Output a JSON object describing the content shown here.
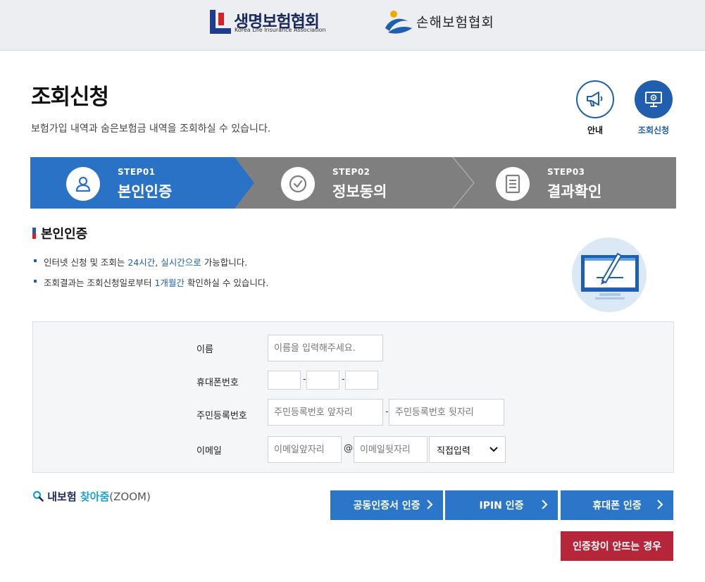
{
  "header": {
    "logo_life_name": "생명보험협회",
    "logo_life_sub": "Korea Life Insurance Association",
    "logo_nonlife_name": "손해보험협회"
  },
  "page": {
    "title": "조회신청",
    "description": "보험가입 내역과 숨은보험금 내역을 조회하실 수 있습니다."
  },
  "quick_links": [
    {
      "label": "안내",
      "icon": "megaphone-icon"
    },
    {
      "label": "조회신청",
      "icon": "monitor-icon"
    }
  ],
  "steps": [
    {
      "num": "STEP01",
      "title": "본인인증",
      "icon": "person-icon",
      "active": true
    },
    {
      "num": "STEP02",
      "title": "정보동의",
      "icon": "check-circle-icon",
      "active": false
    },
    {
      "num": "STEP03",
      "title": "결과확인",
      "icon": "document-icon",
      "active": false
    }
  ],
  "section": {
    "title": "본인인증",
    "bullet1_a": "인터넷 신청 및 조회는 ",
    "bullet1_b": "24시간",
    "bullet1_c": ", ",
    "bullet1_d": "실시간으로",
    "bullet1_e": " 가능합니다.",
    "bullet2_a": "조회결과는 조회신청일로부터 ",
    "bullet2_b": "1개월간",
    "bullet2_c": " 확인하실 수 있습니다."
  },
  "form": {
    "name_label": "이름",
    "name_placeholder": "이름을 입력해주세요.",
    "phone_label": "휴대폰번호",
    "phone_sep": "-",
    "rrn_label": "주민등록번호",
    "rrn_front_placeholder": "주민등록번호 앞자리",
    "rrn_back_placeholder": "주민등록번호 뒷자리",
    "email_label": "이메일",
    "email_front_placeholder": "이메일앞자리",
    "email_at": "@",
    "email_back_placeholder": "이메일뒷자리",
    "email_domain_selected": "직접입력"
  },
  "zoom": {
    "part1": "내보험 ",
    "part2": "찾아줌",
    "part3": "(ZOOM)"
  },
  "buttons": {
    "cert_auth": "공동인증서 인증",
    "ipin_auth": "IPIN 인증",
    "phone_auth": "휴대폰 인증",
    "popup_fail": "인증창이 안뜨는 경우"
  },
  "colors": {
    "primary": "#2b76c9",
    "step_active": "#2a72c6",
    "step_inactive": "#7f7f7f",
    "danger": "#b5263b"
  }
}
